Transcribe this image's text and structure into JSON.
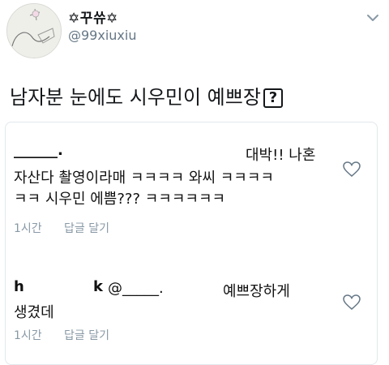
{
  "tweet": {
    "display_name": "✡꾸쓔✡",
    "handle": "@99xiuxiu",
    "text": "남자분 눈에도 시우민이 예쁘장",
    "trailing_box": "?"
  },
  "comments": [
    {
      "author": "______.",
      "lines": [
        "대박!! 나혼",
        "자산다 촬영이라매 ㅋㅋㅋㅋ 와씨 ㅋㅋㅋㅋ",
        "ㅋㅋ 시우민 에쁨??? ㅋㅋㅋㅋㅋㅋ"
      ],
      "time": "1시간",
      "reply_label": "답글 달기"
    },
    {
      "author": "h",
      "author2": "k",
      "mention": "@_____.",
      "lines": [
        "예쁘장하게",
        "생겼데"
      ],
      "time": "1시간",
      "reply_label": "답글 달기"
    }
  ],
  "colors": {
    "text": "#14171a",
    "muted": "#657786",
    "meta": "#8899a6",
    "border": "#e1e8ed"
  },
  "icons": [
    "chevron-down-icon",
    "heart-icon"
  ]
}
